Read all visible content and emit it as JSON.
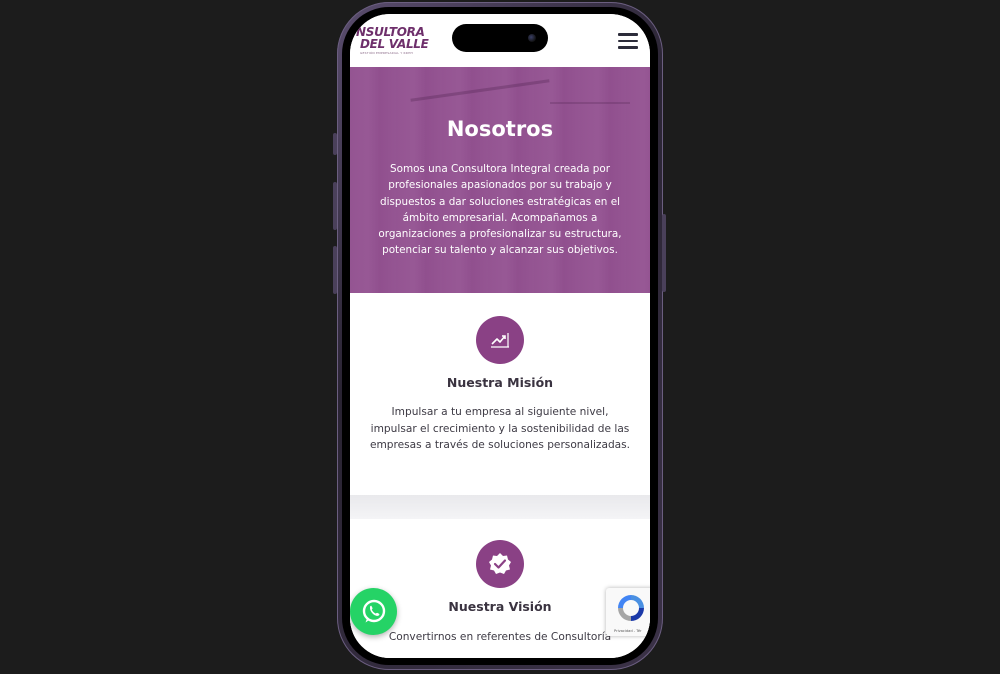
{
  "header": {
    "logo_line1": "NSULTORA",
    "logo_line2": "DEL VALLE",
    "logo_tag": "GESTIÓN EMPRESARIAL Y RRHH"
  },
  "hero": {
    "title": "Nosotros",
    "text": "Somos una Consultora Integral creada por profesionales apasionados por su trabajo y dispuestos a dar soluciones estratégicas en el ámbito empresarial. Acompañamos a organizaciones a profesionalizar su estructura, potenciar su talento y alcanzar sus objetivos."
  },
  "mission": {
    "icon": "chart-trend-icon",
    "title": "Nuestra Misión",
    "text": "Impulsar a tu empresa al siguiente nivel, impulsar el crecimiento y la sostenibilidad de las empresas a través de soluciones personalizadas."
  },
  "vision": {
    "icon": "check-badge-icon",
    "title": "Nuestra Visión",
    "text": "Convertirnos en referentes de Consultoría"
  },
  "recaptcha": {
    "text": "Privacidad - Tér"
  },
  "colors": {
    "brand": "#8a4185",
    "hero_overlay": "#8e478c",
    "whatsapp": "#25d366",
    "background": "#1c1c1c"
  }
}
